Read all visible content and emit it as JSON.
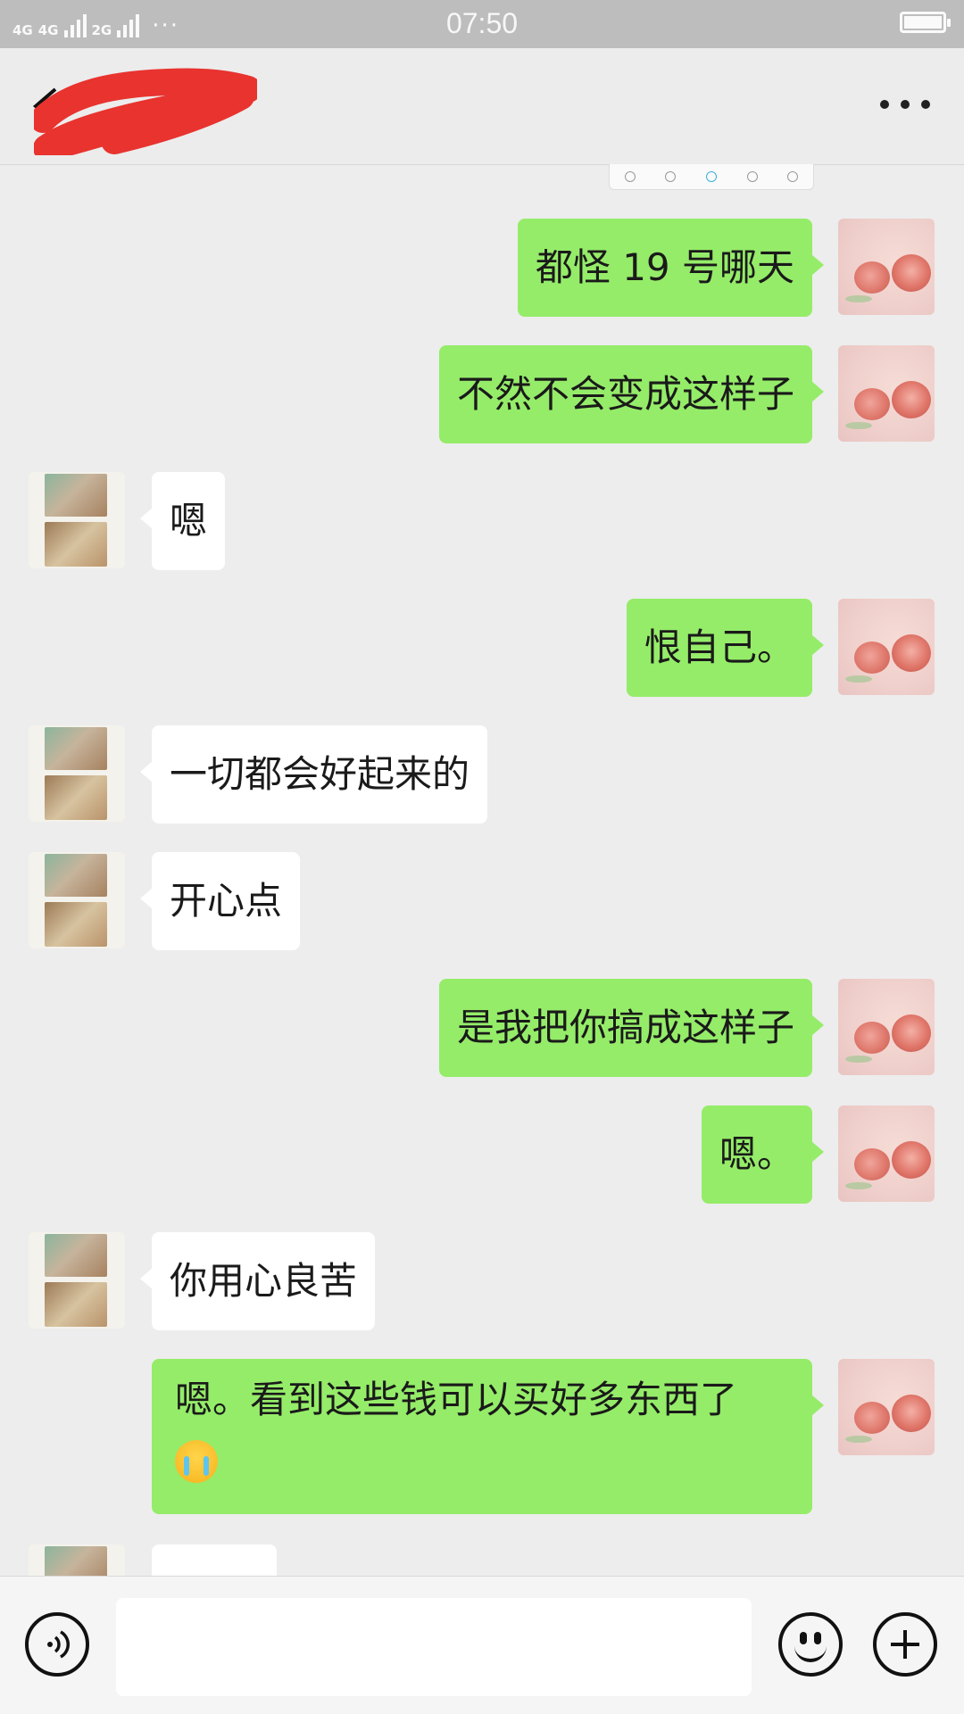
{
  "status_bar": {
    "network_1": "4G",
    "network_2": "4G",
    "network_3": "2G",
    "time": "07:50"
  },
  "header": {
    "contact_name": "",
    "more_icon": "more-dots-icon",
    "back_icon": "chevron-left-icon"
  },
  "messages": [
    {
      "side": "me",
      "text": "都怪 19 号哪天"
    },
    {
      "side": "me",
      "text": "不然不会变成这样子"
    },
    {
      "side": "them",
      "text": "嗯"
    },
    {
      "side": "me",
      "text": "恨自己。"
    },
    {
      "side": "them",
      "text": "一切都会好起来的"
    },
    {
      "side": "them",
      "text": "开心点"
    },
    {
      "side": "me",
      "text": "是我把你搞成这样子"
    },
    {
      "side": "me",
      "text": "嗯。"
    },
    {
      "side": "them",
      "text": "你用心良苦"
    },
    {
      "side": "me",
      "text": "嗯。看到这些钱可以买好多东西了",
      "emoji": "crying-face-emoji"
    }
  ],
  "input_bar": {
    "voice_icon": "voice-icon",
    "emoji_icon": "smiley-icon",
    "plus_icon": "plus-icon",
    "input_value": ""
  },
  "colors": {
    "my_bubble": "#95ec69",
    "their_bubble": "#ffffff",
    "background": "#ededed"
  }
}
